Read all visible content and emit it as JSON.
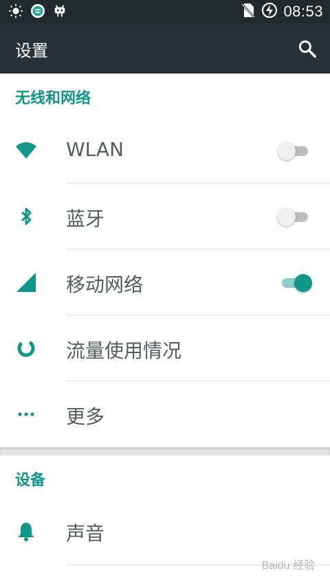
{
  "status_bar": {
    "time": "08:53",
    "left_icons": [
      "brightness-icon",
      "shield-app-icon",
      "android-icon"
    ],
    "right_icons": [
      "no-sim-icon",
      "battery-charging-icon"
    ]
  },
  "app_bar": {
    "title": "设置",
    "search_icon": "search-icon"
  },
  "sections": [
    {
      "header": "无线和网络",
      "items": [
        {
          "label": "WLAN",
          "icon": "wifi-icon",
          "toggle": "off"
        },
        {
          "label": "蓝牙",
          "icon": "bluetooth-icon",
          "toggle": "off"
        },
        {
          "label": "移动网络",
          "icon": "cellular-signal-icon",
          "toggle": "on"
        },
        {
          "label": "流量使用情况",
          "icon": "data-usage-icon"
        },
        {
          "label": "更多",
          "icon": "more-horizontal-icon"
        }
      ]
    },
    {
      "header": "设备",
      "items": [
        {
          "label": "声音",
          "icon": "bell-icon"
        }
      ]
    }
  ],
  "colors": {
    "accent": "#11968a",
    "app_bar": "#263238",
    "status_bar": "#1f292e",
    "label": "#555b5e"
  },
  "watermark": "Baidu 经验"
}
